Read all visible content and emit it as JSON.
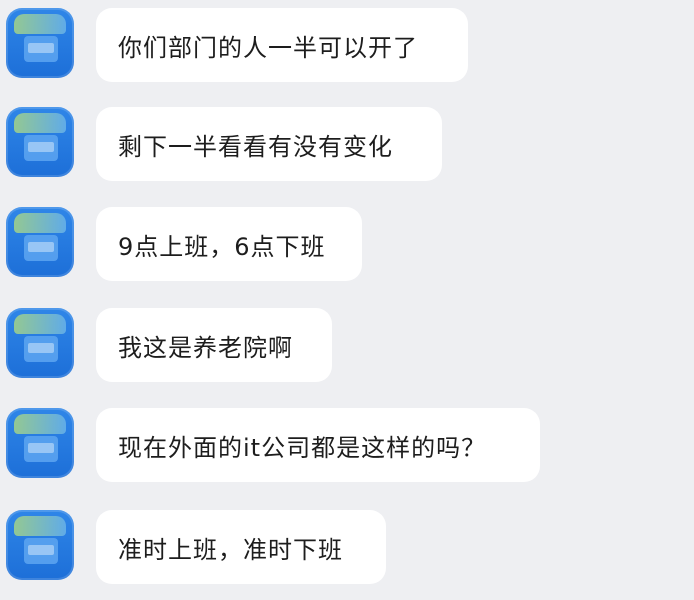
{
  "chat": {
    "messages": [
      {
        "text": "你们部门的人一半可以开了",
        "avatar": "blue-app-avatar"
      },
      {
        "text": "剩下一半看看有没有变化",
        "avatar": "blue-app-avatar"
      },
      {
        "text": "9点上班，6点下班",
        "avatar": "blue-app-avatar"
      },
      {
        "text": "我这是养老院啊",
        "avatar": "blue-app-avatar"
      },
      {
        "text": "现在外面的it公司都是这样的吗？",
        "avatar": "blue-app-avatar"
      },
      {
        "text": "准时上班，准时下班",
        "avatar": "blue-app-avatar"
      }
    ]
  },
  "colors": {
    "background": "#eeeff2",
    "bubble": "#ffffff",
    "avatar": "#2f86e8"
  }
}
